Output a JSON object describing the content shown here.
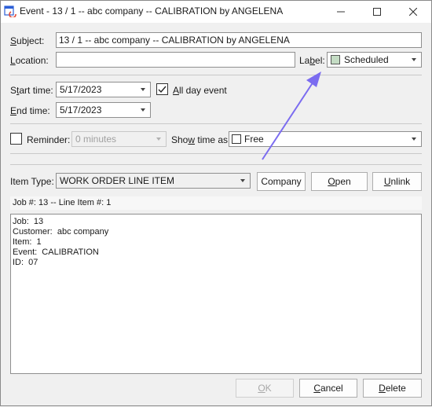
{
  "window": {
    "title": "Event - 13 / 1 -- abc company -- CALIBRATION by ANGELENA"
  },
  "form": {
    "subject_label": "Subject:",
    "subject_value": "13 / 1 -- abc company -- CALIBRATION by ANGELENA",
    "location_label": "Location:",
    "location_value": "",
    "label_label": "Label:",
    "label_value": "Scheduled",
    "label_swatch_color": "#c4dcc4",
    "start_time_label": "Start time:",
    "start_time_value": "5/17/2023",
    "all_day_label": "All day event",
    "all_day_checked": true,
    "end_time_label": "End time:",
    "end_time_value": "5/17/2023",
    "reminder_label": "Reminder:",
    "reminder_value": "0 minutes",
    "show_time_label": "Show time as:",
    "show_time_value": "Free",
    "item_type_label": "Item Type:",
    "item_type_value": "WORK ORDER LINE ITEM",
    "job_line_text": "Job #: 13 -- Line Item #: 1",
    "notes_lines": [
      "Job:  13",
      "Customer:  abc company",
      "Item:  1",
      "Event:  CALIBRATION",
      "ID:  07"
    ]
  },
  "buttons": {
    "company": "Company",
    "open": "Open",
    "unlink": "Unlink",
    "ok": "OK",
    "cancel": "Cancel",
    "delete": "Delete"
  },
  "colors": {
    "arrow": "#7b6cf0"
  }
}
